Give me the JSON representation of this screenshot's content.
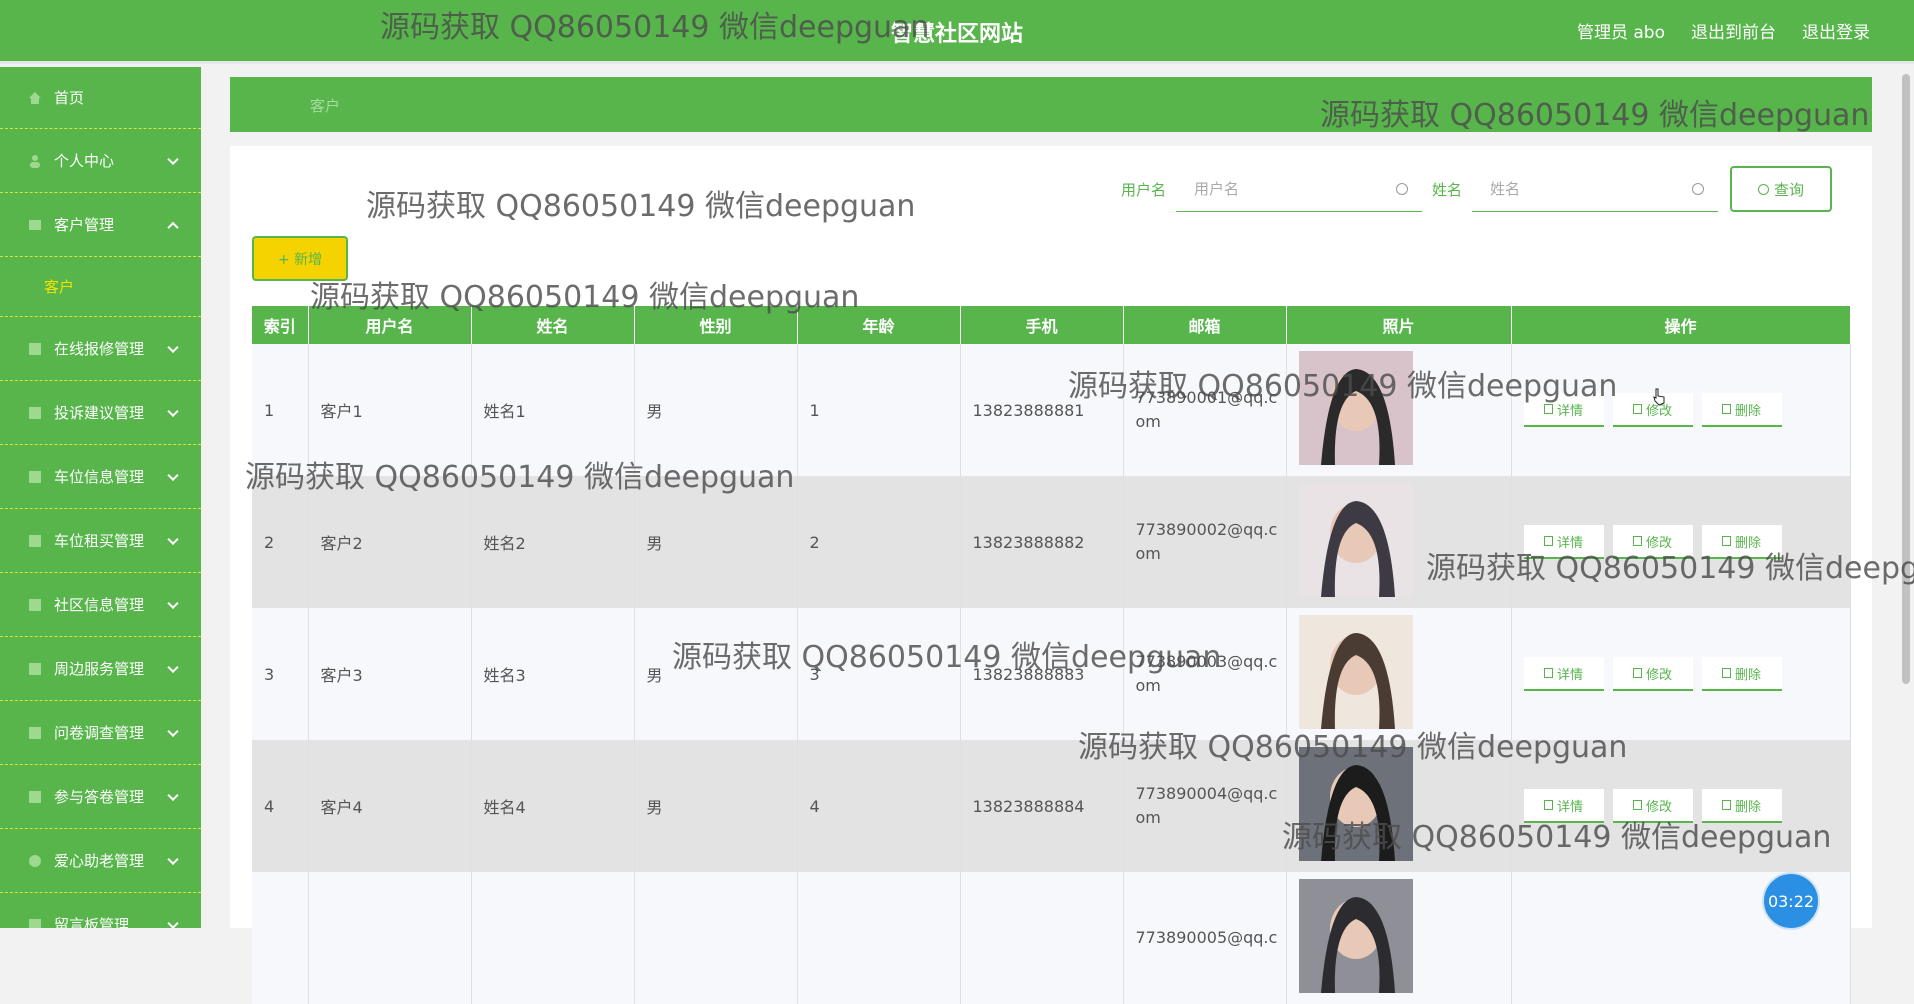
{
  "header": {
    "title": "智慧社区网站",
    "admin": "管理员 abo",
    "front": "退出到前台",
    "logout": "退出登录"
  },
  "sidebar": {
    "items": [
      {
        "label": "首页",
        "icon": "home-icon"
      },
      {
        "label": "个人中心",
        "icon": "user-icon"
      },
      {
        "label": "客户管理",
        "icon": "users-icon",
        "expanded": true,
        "sub": "客户"
      },
      {
        "label": "在线报修管理",
        "icon": "repair-icon"
      },
      {
        "label": "投诉建议管理",
        "icon": "complaint-icon"
      },
      {
        "label": "车位信息管理",
        "icon": "parking-icon"
      },
      {
        "label": "车位租买管理",
        "icon": "car-icon"
      },
      {
        "label": "社区信息管理",
        "icon": "info-icon"
      },
      {
        "label": "周边服务管理",
        "icon": "service-icon"
      },
      {
        "label": "问卷调查管理",
        "icon": "survey-icon"
      },
      {
        "label": "参与答卷管理",
        "icon": "answer-icon"
      },
      {
        "label": "爱心助老管理",
        "icon": "heart-icon"
      },
      {
        "label": "留言板管理",
        "icon": "message-icon"
      }
    ]
  },
  "breadcrumb": "客户",
  "search": {
    "username_label": "用户名",
    "username_placeholder": "用户名",
    "name_label": "姓名",
    "name_placeholder": "姓名",
    "query_button": "查询"
  },
  "add_button": "+ 新增",
  "table": {
    "headers": [
      "索引",
      "用户名",
      "姓名",
      "性别",
      "年龄",
      "手机",
      "邮箱",
      "照片",
      "操作"
    ],
    "rows": [
      {
        "index": "1",
        "username": "客户1",
        "name": "姓名1",
        "gender": "男",
        "age": "1",
        "phone": "13823888881",
        "email": "773890001@qq.com"
      },
      {
        "index": "2",
        "username": "客户2",
        "name": "姓名2",
        "gender": "男",
        "age": "2",
        "phone": "13823888882",
        "email": "773890002@qq.com"
      },
      {
        "index": "3",
        "username": "客户3",
        "name": "姓名3",
        "gender": "男",
        "age": "3",
        "phone": "13823888883",
        "email": "773890003@qq.com"
      },
      {
        "index": "4",
        "username": "客户4",
        "name": "姓名4",
        "gender": "男",
        "age": "4",
        "phone": "13823888884",
        "email": "773890004@qq.com"
      },
      {
        "index": "",
        "username": "",
        "name": "",
        "gender": "",
        "age": "",
        "phone": "",
        "email": "773890005@qq.c"
      }
    ],
    "ops": {
      "detail": "详情",
      "edit": "修改",
      "delete": "删除"
    }
  },
  "watermark": "源码获取 QQ86050149 微信deepguan",
  "timer": "03:22",
  "colors": {
    "primary": "#57b54c",
    "accent_yellow": "#f5d300",
    "timer_blue": "#2b8fe3"
  }
}
